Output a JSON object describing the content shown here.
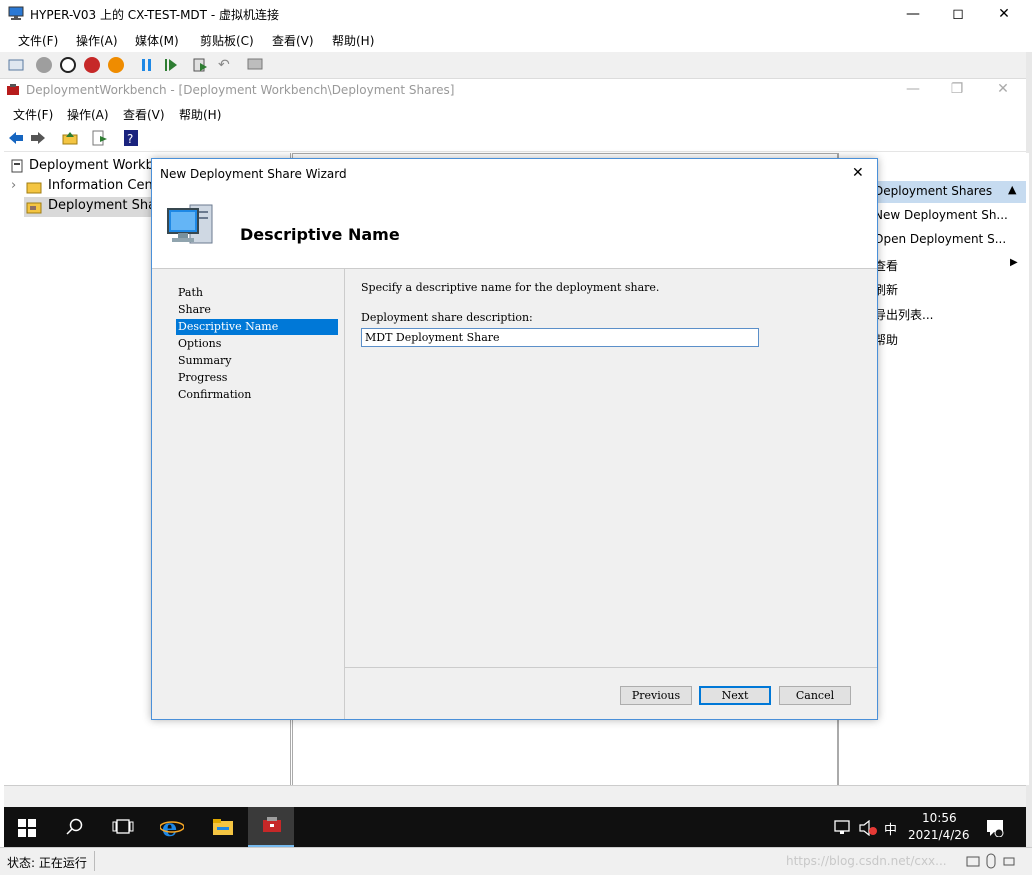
{
  "host": {
    "title": "HYPER-V03 上的 CX-TEST-MDT - 虚拟机连接",
    "menu": [
      "文件(F)",
      "操作(A)",
      "媒体(M)",
      "剪贴板(C)",
      "查看(V)",
      "帮助(H)"
    ],
    "status": "状态: 正在运行"
  },
  "guest": {
    "title": "DeploymentWorkbench - [Deployment Workbench\\Deployment Shares]",
    "menu": [
      "文件(F)",
      "操作(A)",
      "查看(V)",
      "帮助(H)"
    ],
    "tree": {
      "root": "Deployment Workbench",
      "items": [
        "Information Center",
        "Deployment Shares"
      ]
    },
    "actions": {
      "header": "Deployment Shares",
      "items": [
        "New Deployment Sh...",
        "Open Deployment S...",
        "查看",
        "刷新",
        "导出列表...",
        "帮助"
      ]
    }
  },
  "wizard": {
    "title": "New Deployment Share Wizard",
    "heading": "Descriptive Name",
    "nav": [
      "Path",
      "Share",
      "Descriptive Name",
      "Options",
      "Summary",
      "Progress",
      "Confirmation"
    ],
    "selected_nav": "Descriptive Name",
    "instruction": "Specify a descriptive name for the deployment share.",
    "field_label": "Deployment share description:",
    "field_value": "MDT Deployment Share",
    "buttons": {
      "previous": "Previous",
      "next": "Next",
      "cancel": "Cancel"
    }
  },
  "taskbar": {
    "time": "10:56",
    "date": "2021/4/26",
    "ime": "中"
  },
  "watermark": "https://blog.csdn.net/cxx..."
}
